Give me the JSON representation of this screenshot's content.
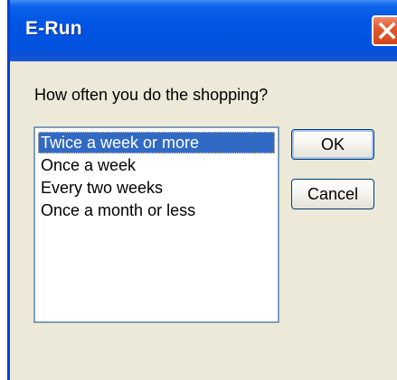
{
  "window": {
    "title": "E-Run"
  },
  "dialog": {
    "prompt": "How often you do the shopping?",
    "options": [
      "Twice a week or more",
      "Once a week",
      "Every two weeks",
      "Once a month or less"
    ],
    "selected_option": "Twice a week or more",
    "ok_label": "OK",
    "cancel_label": "Cancel"
  },
  "colors": {
    "titlebar": "#0055e3",
    "selection": "#316ac5",
    "close_button": "#e2592f",
    "dialog_background": "#ece9d8"
  },
  "icons": {
    "close": "close-icon"
  }
}
